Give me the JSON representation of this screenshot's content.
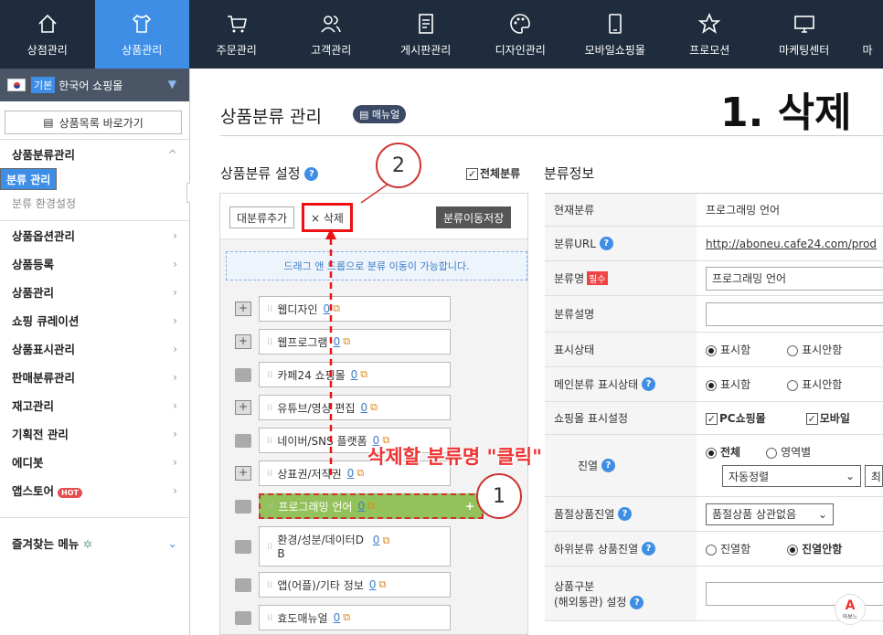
{
  "topnav": [
    {
      "label": "상점관리",
      "icon": "home-icon"
    },
    {
      "label": "상품관리",
      "icon": "shirt-icon",
      "active": true
    },
    {
      "label": "주문관리",
      "icon": "cart-icon"
    },
    {
      "label": "고객관리",
      "icon": "users-icon"
    },
    {
      "label": "게시판관리",
      "icon": "board-icon"
    },
    {
      "label": "디자인관리",
      "icon": "palette-icon"
    },
    {
      "label": "모바일쇼핑몰",
      "icon": "mobile-icon"
    },
    {
      "label": "프로모션",
      "icon": "star-icon"
    },
    {
      "label": "마케팅센터",
      "icon": "monitor-icon"
    },
    {
      "label": "마",
      "icon": "partial-icon"
    }
  ],
  "sidebar": {
    "shop_badge": "기본",
    "shop_name": "한국어 쇼핑몰",
    "list_button": "상품목록 바로가기",
    "section_title": "상품분류관리",
    "sub_items": [
      "분류 관리",
      "분류 환경설정"
    ],
    "menu": [
      "상품옵션관리",
      "상품등록",
      "상품관리",
      "쇼핑 큐레이션",
      "상품표시관리",
      "판매분류관리",
      "재고관리",
      "기획전 관리",
      "에디봇",
      "앱스토어"
    ],
    "hot": "HOT",
    "favorites": "즐겨찾는 메뉴"
  },
  "main": {
    "page_title": "상품분류 관리",
    "manual_label": "매뉴얼",
    "big_title": "1. 삭제",
    "section_title": "상품분류 설정",
    "all_cat": "전체분류",
    "info_title": "분류정보",
    "buttons": {
      "add": "대분류추가",
      "delete": "× 삭제",
      "save": "분류이동저장"
    },
    "drag_hint": "드래그 앤 드롭으로 분류 이동이 가능합니다.",
    "nodes": [
      {
        "label": "웹디자인",
        "count": "0",
        "plus": true
      },
      {
        "label": "웹프로그램",
        "count": "0",
        "plus": true
      },
      {
        "label": "카페24 쇼핑몰",
        "count": "0",
        "plus": false
      },
      {
        "label": "유튜브/영상 편집",
        "count": "0",
        "plus": true
      },
      {
        "label": "네이버/SNS 플랫폼",
        "count": "0",
        "plus": false
      },
      {
        "label": "상표권/저작권",
        "count": "0",
        "plus": true
      },
      {
        "label": "프로그래밍 언어",
        "count": "0",
        "plus": false,
        "selected": true
      },
      {
        "label": "환경/성분/데이터D",
        "label2": "B",
        "count": "0",
        "plus": false
      },
      {
        "label": "앱(어플)/기타 정보",
        "count": "0",
        "plus": false
      },
      {
        "label": "효도매뉴얼",
        "count": "0",
        "plus": false
      }
    ],
    "info": {
      "current_label": "현재분류",
      "current_val": "프로그래밍 언어",
      "url_label": "분류URL",
      "url_val": "http://aboneu.cafe24.com/prod",
      "name_label": "분류명",
      "required": "필수",
      "name_val": "프로그래밍 언어",
      "desc_label": "분류설명",
      "display_label": "표시상태",
      "show": "표시함",
      "hide": "표시안함",
      "main_display_label": "메인분류 표시상태",
      "mall_label": "쇼핑몰 표시설정",
      "pc": "PC쇼핑몰",
      "mobile": "모바일",
      "arrange_label": "진열",
      "all": "전체",
      "area": "영역별",
      "sort": "자동정렬",
      "sort2": "최",
      "soldout_label": "품절상품진열",
      "soldout_val": "품절상품 상관없음",
      "sub_label": "하위분류 상품진열",
      "sub_on": "진열함",
      "sub_off": "진열안함",
      "type_label": "상품구분",
      "type_label2": "(해외통관) 설정"
    }
  },
  "annotations": {
    "step1": "1",
    "step2": "2",
    "click_text": "삭제할 분류명 \"클릭\""
  },
  "logo_text": "아보느"
}
